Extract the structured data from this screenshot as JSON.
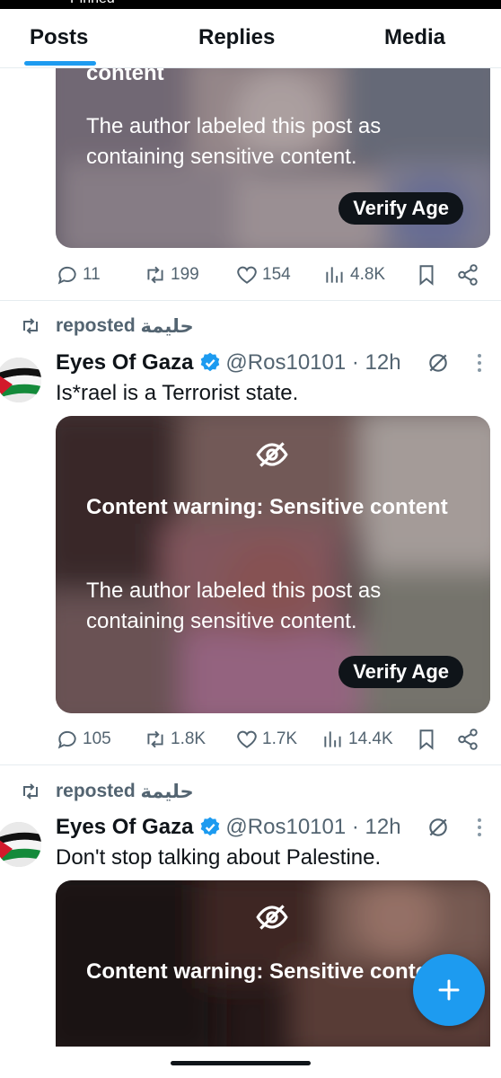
{
  "top_strip_text": "Pinned",
  "tabs": [
    {
      "label": "Posts",
      "active": true
    },
    {
      "label": "Replies",
      "active": false
    },
    {
      "label": "Media",
      "active": false
    }
  ],
  "posts": [
    {
      "media": {
        "cw_title_tail": "content",
        "cw_desc": "The author labeled this post as containing sensitive content.",
        "verify_label": "Verify Age"
      },
      "stats": {
        "replies": "11",
        "reposts": "199",
        "likes": "154",
        "views": "4.8K"
      }
    },
    {
      "repost_label": "reposted",
      "reposter": "حليمة",
      "author": "Eyes Of Gaza",
      "handle": "@Ros10101",
      "time": "· 12h",
      "text": "Is*rael is a Terrorist state.",
      "media": {
        "cw_title": "Content warning: Sensitive content",
        "cw_desc": "The author labeled this post as containing sensitive content.",
        "verify_label": "Verify Age"
      },
      "stats": {
        "replies": "105",
        "reposts": "1.8K",
        "likes": "1.7K",
        "views": "14.4K"
      }
    },
    {
      "repost_label": "reposted",
      "reposter": "حليمة",
      "author": "Eyes Of Gaza",
      "handle": "@Ros10101",
      "time": "· 12h",
      "text": "Don't stop talking about Palestine.",
      "media": {
        "cw_title": "Content warning: Sensitive content"
      }
    }
  ],
  "colors": {
    "accent": "#1d9bf0",
    "text": "#0f1419",
    "muted": "#536471"
  },
  "icons": [
    "reply-icon",
    "repost-icon",
    "like-icon",
    "views-icon",
    "bookmark-icon",
    "share-icon",
    "verified-icon",
    "eye-slash-icon",
    "grok-icon",
    "more-icon",
    "compose-icon"
  ]
}
